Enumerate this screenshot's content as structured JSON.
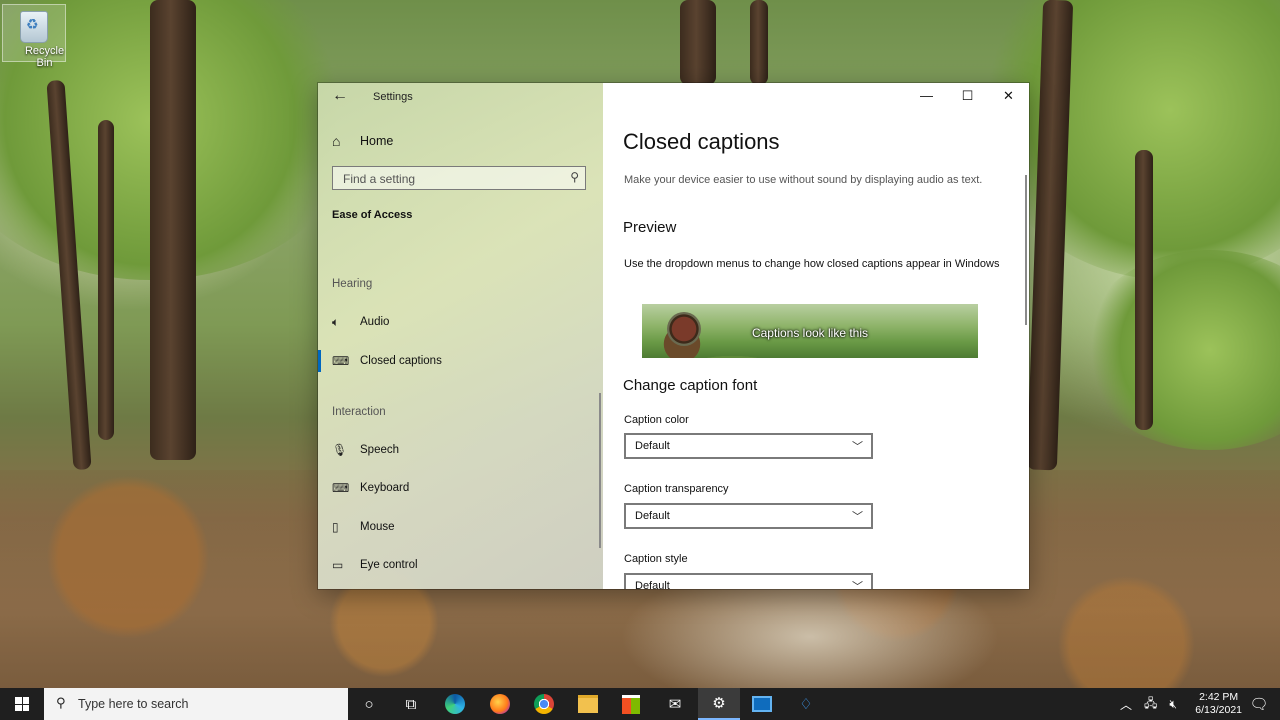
{
  "desktop": {
    "icons": [
      {
        "label": "Recycle Bin",
        "icon": "recycle-bin-icon"
      }
    ]
  },
  "window": {
    "title": "Settings",
    "controls": {
      "minimize": "—",
      "maximize": "☐",
      "close": "✕"
    },
    "sidebar": {
      "home": "Home",
      "search_placeholder": "Find a setting",
      "section": "Ease of Access",
      "groups": [
        {
          "heading": "Hearing",
          "items": [
            {
              "label": "Audio",
              "icon": "speaker-icon"
            },
            {
              "label": "Closed captions",
              "icon": "captions-icon",
              "selected": true
            }
          ]
        },
        {
          "heading": "Interaction",
          "items": [
            {
              "label": "Speech",
              "icon": "microphone-icon"
            },
            {
              "label": "Keyboard",
              "icon": "keyboard-icon"
            },
            {
              "label": "Mouse",
              "icon": "mouse-icon"
            },
            {
              "label": "Eye control",
              "icon": "eye-control-icon"
            }
          ]
        }
      ]
    },
    "content": {
      "title": "Closed captions",
      "description": "Make your device easier to use without sound by displaying audio as text.",
      "preview_heading": "Preview",
      "preview_description": "Use the dropdown menus to change how closed captions appear in Windows",
      "preview_caption": "Captions look like this",
      "font_heading": "Change caption font",
      "settings": [
        {
          "label": "Caption color",
          "value": "Default"
        },
        {
          "label": "Caption transparency",
          "value": "Default"
        },
        {
          "label": "Caption style",
          "value": "Default"
        }
      ]
    }
  },
  "taskbar": {
    "search_placeholder": "Type here to search",
    "apps": [
      "cortana-icon",
      "task-view-icon",
      "edge-icon",
      "firefox-icon",
      "chrome-icon",
      "file-explorer-icon",
      "store-icon",
      "mail-icon",
      "settings-icon",
      "outlook-icon",
      "azure-devops-icon"
    ],
    "time": "2:42 PM",
    "date": "6/13/2021",
    "accent": "#0067c0"
  }
}
